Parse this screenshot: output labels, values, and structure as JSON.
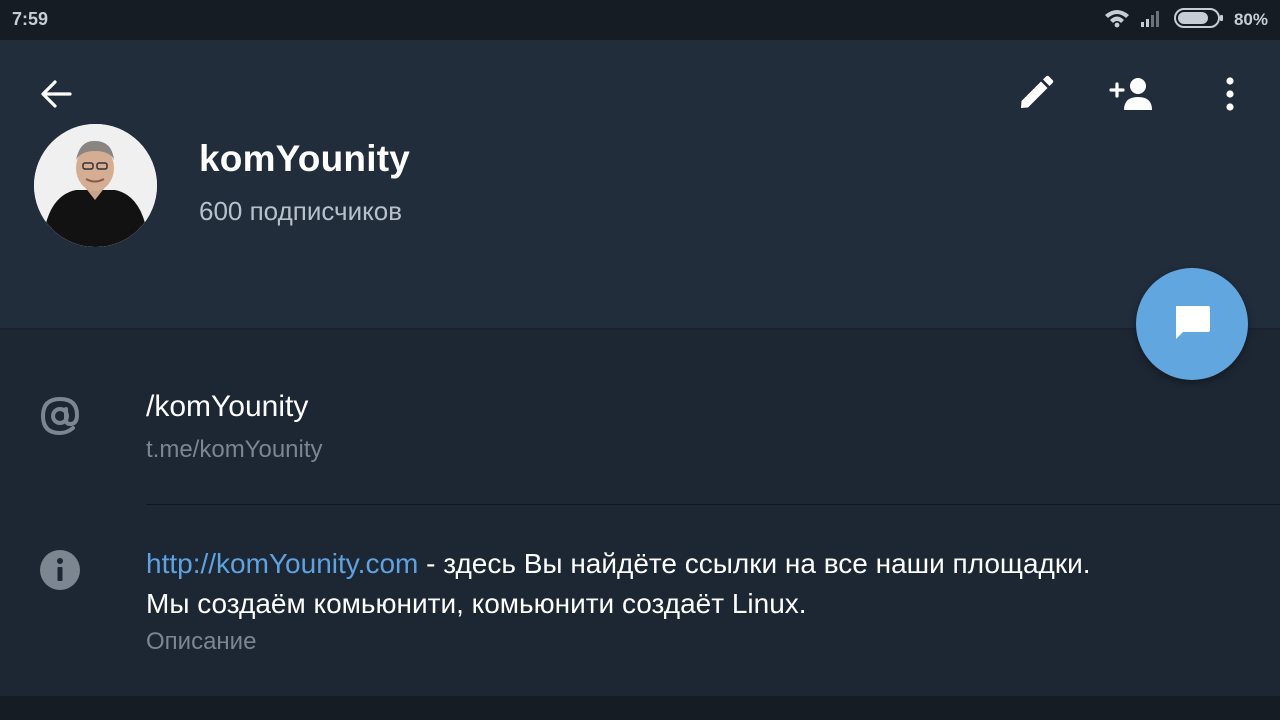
{
  "status_bar": {
    "time": "7:59",
    "battery_percent": "80%",
    "battery_level": 0.8
  },
  "toolbar": {
    "back_icon": "arrow-left-icon",
    "edit_icon": "pencil-icon",
    "add_member_icon": "person-add-icon",
    "menu_icon": "more-vertical-icon"
  },
  "channel": {
    "name": "komYounity",
    "subscribers": "600 подписчиков"
  },
  "info": {
    "username": "/komYounity",
    "link": "t.me/komYounity",
    "description_url": "http://komYounity.com",
    "description_line1": " - здесь Вы найдёте ссылки на все наши площадки.",
    "description_line2": "Мы создаём комьюнити, комьюнити создаёт Linux.",
    "description_label": "Описание"
  },
  "colors": {
    "header_bg": "#212d3b",
    "body_bg": "#1d2733",
    "accent": "#62a6e0",
    "link": "#5ea2df",
    "secondary_text": "#7b8691"
  }
}
